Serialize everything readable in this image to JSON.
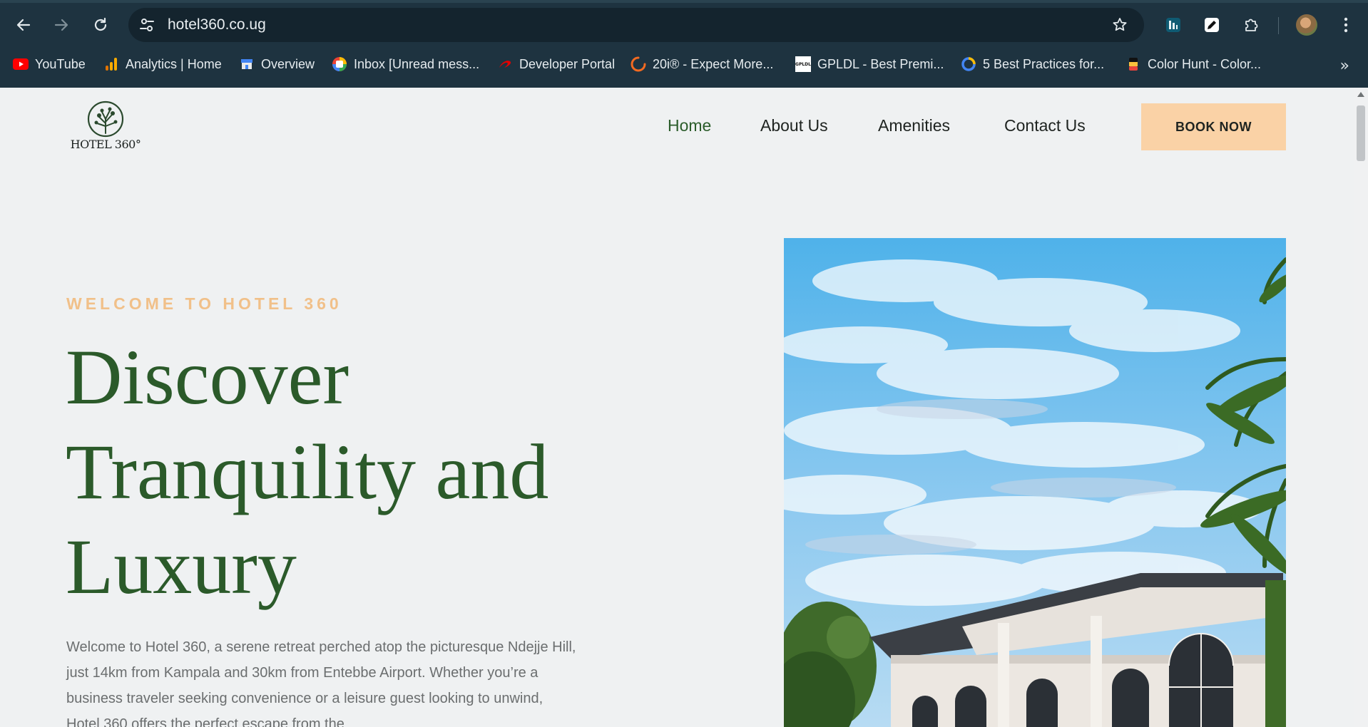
{
  "browser": {
    "url": "hotel360.co.ug",
    "bookmarks": [
      {
        "label": "YouTube",
        "icon": "youtube-icon"
      },
      {
        "label": "Analytics | Home",
        "icon": "analytics-icon"
      },
      {
        "label": "Overview",
        "icon": "store-icon"
      },
      {
        "label": "Inbox [Unread mess...",
        "icon": "inbox-icon"
      },
      {
        "label": "Developer Portal",
        "icon": "airtel-icon"
      },
      {
        "label": "20i® - Expect More...",
        "icon": "20i-icon"
      },
      {
        "label": "GPLDL - Best Premi...",
        "icon": "gpldl-icon"
      },
      {
        "label": "5 Best Practices for...",
        "icon": "ring-icon"
      },
      {
        "label": "Color Hunt - Color...",
        "icon": "colorhunt-icon"
      }
    ],
    "gpldl_badge": "GPLDL"
  },
  "site": {
    "logo_text": "HOTEL 360°",
    "nav": [
      "Home",
      "About Us",
      "Amenities",
      "Contact Us"
    ],
    "book_label": "BOOK NOW"
  },
  "hero": {
    "eyebrow": "WELCOME TO HOTEL 360",
    "headline": "Discover Tranquility and Luxury",
    "paragraph": "Welcome to Hotel 360, a serene retreat perched atop the picturesque Ndejje Hill, just 14km from Kampala and 30km from Entebbe Airport. Whether you’re a business traveler seeking convenience or a leisure guest looking to unwind, Hotel 360 offers the perfect escape from the"
  },
  "colors": {
    "brand_green": "#2b5a2a",
    "accent_peach": "#fad2a6",
    "eyebrow_orange": "#f1c089",
    "chrome_bg": "#1e3340"
  }
}
